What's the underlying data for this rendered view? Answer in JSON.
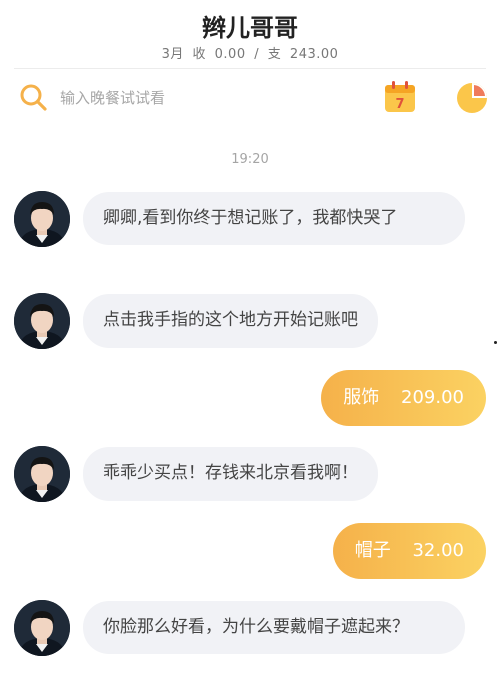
{
  "header": {
    "title": "辫儿哥哥",
    "month": "3月",
    "income_label": "收",
    "income": "0.00",
    "separator": "/",
    "expense_label": "支",
    "expense": "243.00"
  },
  "search": {
    "placeholder": "输入晚餐试试看",
    "calendar_day": "7"
  },
  "chat": {
    "timestamp": "19:20",
    "messages": [
      {
        "side": "left",
        "text": "卿卿,看到你终于想记账了，我都快哭了"
      },
      {
        "side": "left",
        "text": "点击我手指的这个地方开始记账吧"
      },
      {
        "side": "right",
        "category": "服饰",
        "amount": "209.00"
      },
      {
        "side": "left",
        "text": "乖乖少买点！存钱来北京看我啊！"
      },
      {
        "side": "right",
        "category": "帽子",
        "amount": "32.00"
      },
      {
        "side": "left",
        "text": "你脸那么好看，为什么要戴帽子遮起来？"
      }
    ]
  },
  "colors": {
    "accent": "#f5b14a",
    "accent_light": "#fbd262",
    "bubble_bg": "#f1f2f6"
  }
}
